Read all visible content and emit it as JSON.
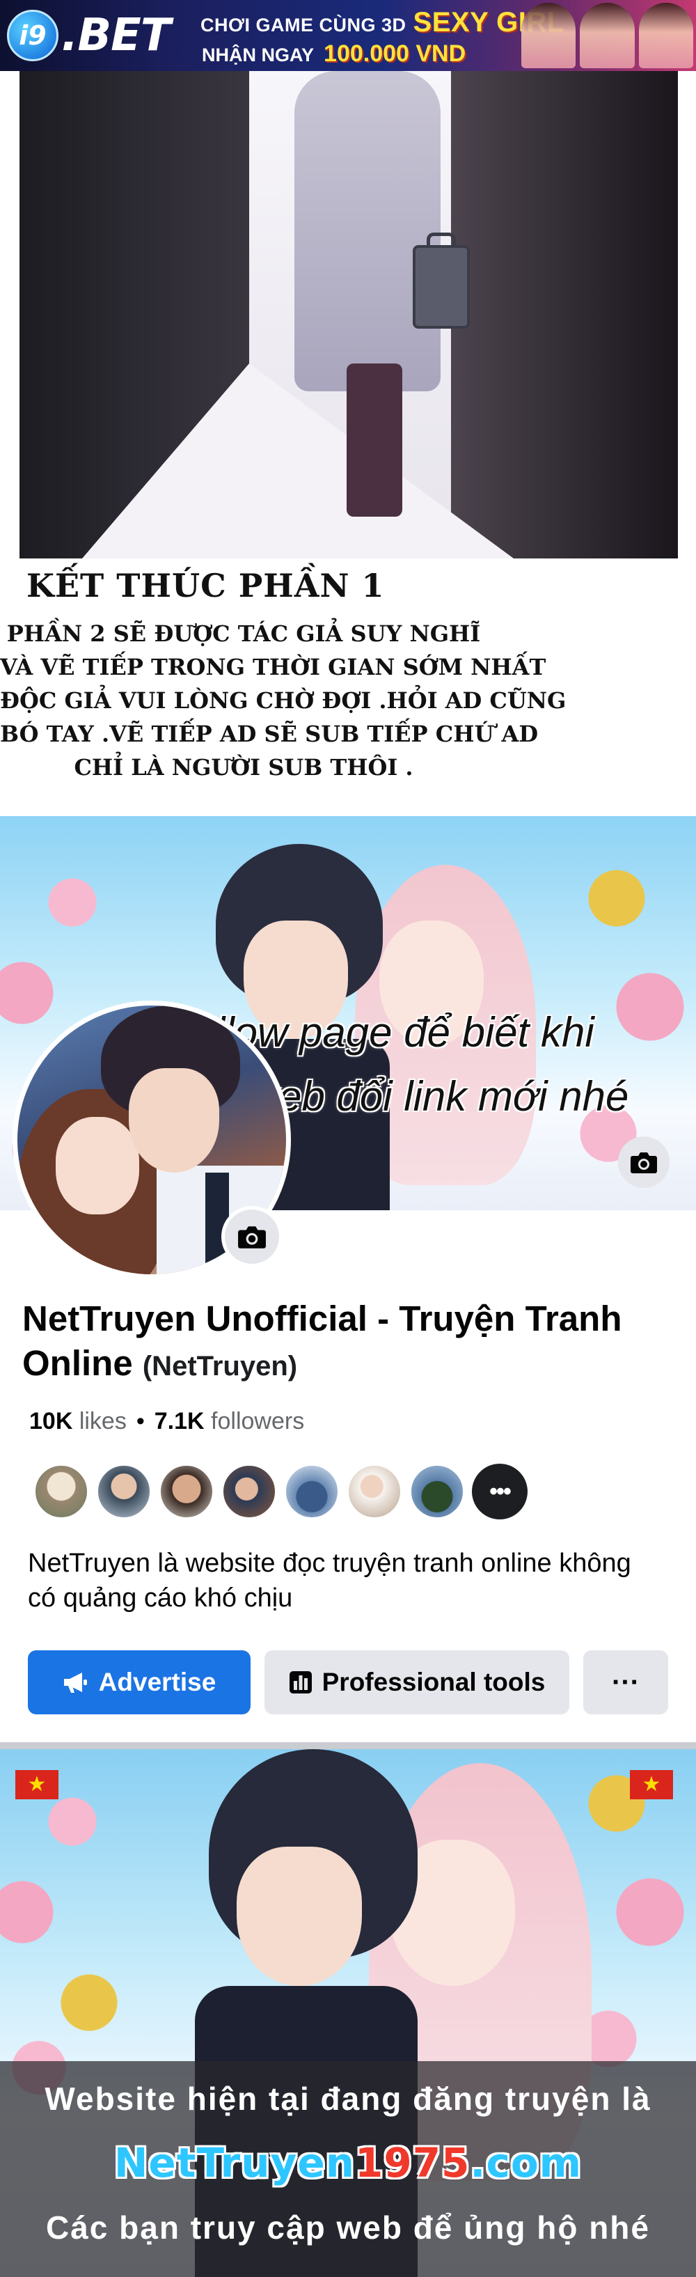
{
  "ad_banner": {
    "logo_badge": "i9",
    "logo_text": ".BET",
    "line1": "CHƠI GAME CÙNG 3D",
    "line1_highlight": "SEXY GIRL",
    "line2": "NHẬN NGAY",
    "line2_highlight": "100.000 VND"
  },
  "chapter_end": {
    "title": "KẾT THÚC PHẦN 1",
    "lines": [
      "PHẦN 2 SẼ ĐƯỢC TÁC GIẢ SUY NGHĨ",
      "VÀ VẼ TIẾP TRONG THỜI GIAN SỚM NHẤT",
      "ĐỘC GIẢ VUI LÒNG CHỜ ĐỢI .HỎI AD CŨNG",
      "BÓ TAY .VẼ TIẾP AD SẼ SUB TIẾP CHỨ AD",
      "CHỈ LÀ NGƯỜI SUB THÔI ."
    ]
  },
  "facebook_page": {
    "cover_caption_line1": "Follow page để biết khi",
    "cover_caption_line2": "nào web đổi link mới nhé",
    "name": "NetTruyen Unofficial - Truyện Tranh Online",
    "handle": "(NetTruyen)",
    "likes_count": "10K",
    "likes_label": "likes",
    "separator": "•",
    "followers_count": "7.1K",
    "followers_label": "followers",
    "more_followers": "•••",
    "bio": "NetTruyen là website đọc truyện tranh online không có quảng cáo khó chịu",
    "buttons": {
      "advertise": "Advertise",
      "professional_tools": "Professional tools",
      "more": "···"
    },
    "icons": {
      "cover_camera": "camera-icon",
      "profile_camera": "camera-icon",
      "advertise": "megaphone-icon",
      "tools": "bar-chart-icon"
    },
    "colors": {
      "primary_button": "#1b74e4",
      "secondary_button": "#e4e6eb"
    }
  },
  "promo": {
    "line1": "Website hiện tại đang đăng truyện là",
    "site_prefix": "NetTruyen",
    "site_number": "1975",
    "site_suffix": ".com",
    "line3": "Các bạn truy cập web để ủng hộ nhé"
  }
}
